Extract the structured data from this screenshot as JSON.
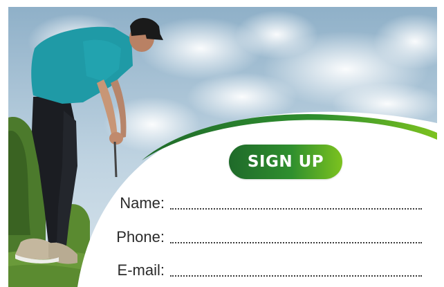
{
  "signup": {
    "button_label": "SIGN UP"
  },
  "form": {
    "fields": [
      {
        "label": "Name:",
        "value": ""
      },
      {
        "label": "Phone:",
        "value": ""
      },
      {
        "label": "E-mail:",
        "value": ""
      }
    ]
  },
  "colors": {
    "accent_green_dark": "#1f6a2a",
    "accent_green_light": "#7cc21f",
    "sky": "#a9c4da",
    "shirt": "#1f9aa6"
  },
  "icons": {
    "photo": "golfer-photo"
  }
}
